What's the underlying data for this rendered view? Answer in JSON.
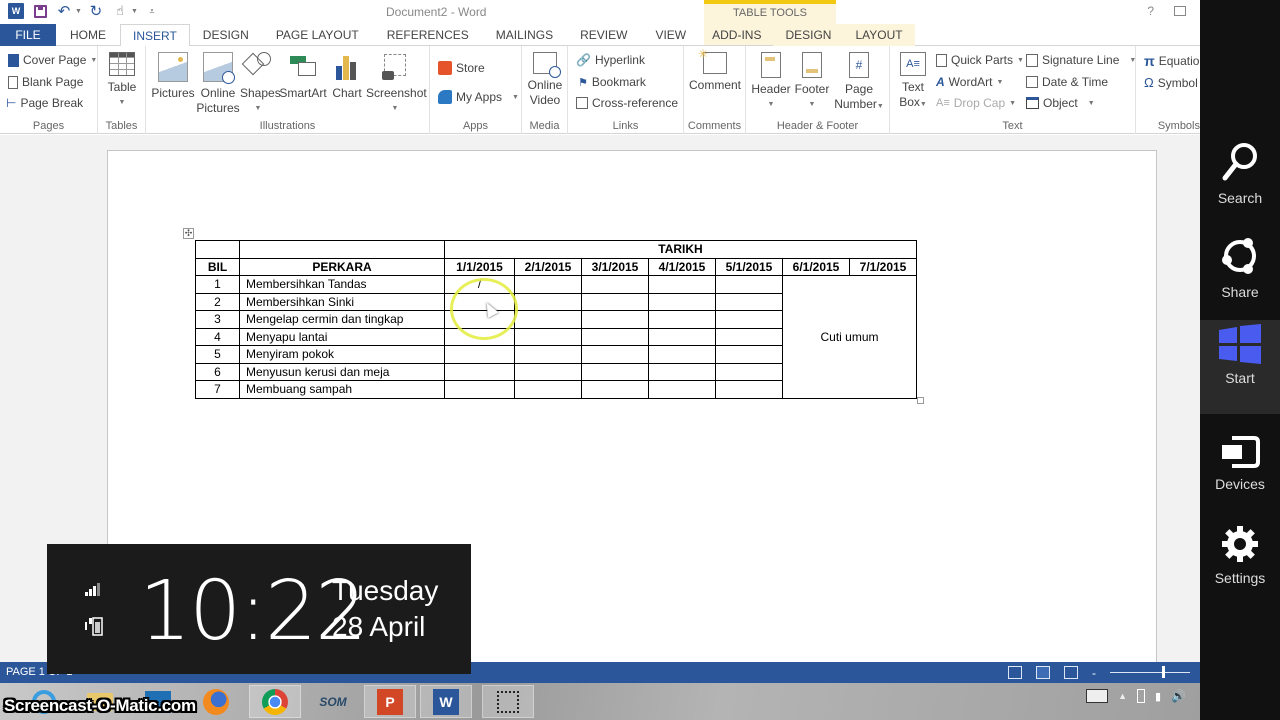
{
  "window": {
    "title": "Document2 - Word",
    "help_label": "?",
    "context_group": "TABLE TOOLS"
  },
  "tabs": [
    {
      "label": "FILE"
    },
    {
      "label": "HOME"
    },
    {
      "label": "INSERT"
    },
    {
      "label": "DESIGN"
    },
    {
      "label": "PAGE LAYOUT"
    },
    {
      "label": "REFERENCES"
    },
    {
      "label": "MAILINGS"
    },
    {
      "label": "REVIEW"
    },
    {
      "label": "VIEW"
    },
    {
      "label": "ADD-INS"
    },
    {
      "label": "DESIGN"
    },
    {
      "label": "LAYOUT"
    }
  ],
  "ribbon": {
    "pages": {
      "label": "Pages",
      "cover_page": "Cover Page",
      "blank_page": "Blank Page",
      "page_break": "Page Break"
    },
    "tables": {
      "label": "Tables",
      "table": "Table"
    },
    "illustrations": {
      "label": "Illustrations",
      "pictures": "Pictures",
      "online_pictures_1": "Online",
      "online_pictures_2": "Pictures",
      "shapes": "Shapes",
      "smartart": "SmartArt",
      "chart": "Chart",
      "screenshot": "Screenshot"
    },
    "apps": {
      "label": "Apps",
      "store": "Store",
      "my_apps": "My Apps"
    },
    "media": {
      "label": "Media",
      "online_video_1": "Online",
      "online_video_2": "Video"
    },
    "links": {
      "label": "Links",
      "hyperlink": "Hyperlink",
      "bookmark": "Bookmark",
      "cross_reference": "Cross-reference"
    },
    "comments": {
      "label": "Comments",
      "comment": "Comment"
    },
    "header_footer": {
      "label": "Header & Footer",
      "header": "Header",
      "footer": "Footer",
      "page_number_1": "Page",
      "page_number_2": "Number"
    },
    "text": {
      "label": "Text",
      "text_box_1": "Text",
      "text_box_2": "Box",
      "quick_parts": "Quick Parts",
      "wordart": "WordArt",
      "drop_cap": "Drop Cap",
      "signature_line": "Signature Line",
      "date_time": "Date & Time",
      "object": "Object"
    },
    "symbols": {
      "label": "Symbols",
      "equation": "Equation",
      "symbol": "Symbol"
    }
  },
  "table": {
    "group_header": "TARIKH",
    "col_bil": "BIL",
    "col_perkara": "PERKARA",
    "dates": [
      "1/1/2015",
      "2/1/2015",
      "3/1/2015",
      "4/1/2015",
      "5/1/2015",
      "6/1/2015",
      "7/1/2015"
    ],
    "merged_note": "Cuti umum",
    "rows": [
      {
        "bil": "1",
        "perkara": "Membersihkan Tandas",
        "d1": "/"
      },
      {
        "bil": "2",
        "perkara": "Membersihkan Sinki",
        "d1": ""
      },
      {
        "bil": "3",
        "perkara": "Mengelap cermin dan tingkap",
        "d1": ""
      },
      {
        "bil": "4",
        "perkara": "Menyapu lantai",
        "d1": ""
      },
      {
        "bil": "5",
        "perkara": "Menyiram pokok",
        "d1": ""
      },
      {
        "bil": "6",
        "perkara": "Menyusun kerusi dan meja",
        "d1": ""
      },
      {
        "bil": "7",
        "perkara": "Membuang sampah",
        "d1": ""
      }
    ]
  },
  "statusbar": {
    "page": "PAGE 1 OF 1"
  },
  "clock": {
    "time": "10:22",
    "day": "Tuesday",
    "date": "28 April"
  },
  "charms": [
    {
      "label": "Search"
    },
    {
      "label": "Share"
    },
    {
      "label": "Start"
    },
    {
      "label": "Devices"
    },
    {
      "label": "Settings"
    }
  ],
  "taskbar": {
    "watermark": "Screencast-O-Matic.com",
    "som_label": "SOM"
  },
  "colors": {
    "word_blue": "#2b579a",
    "context_yellow": "#f2c811",
    "start_blue": "#4a5cf0"
  }
}
